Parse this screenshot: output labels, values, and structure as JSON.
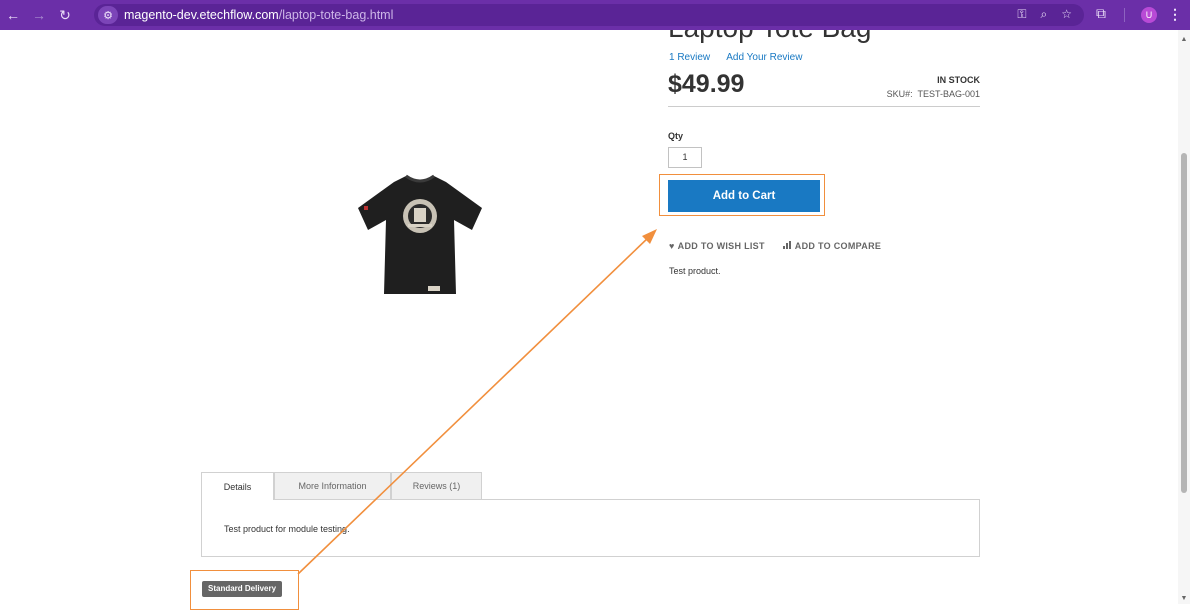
{
  "browser": {
    "url_host": "magento-dev.etechflow.com",
    "url_path": "/laptop-tote-bag.html",
    "avatar_initial": "U",
    "theme_color": "#6b2fa8"
  },
  "product": {
    "title": "Laptop Tote Bag",
    "review_count_label": "1  Review",
    "add_review_label": "Add Your Review",
    "price": "$49.99",
    "stock_status": "IN STOCK",
    "sku_label": "SKU#:",
    "sku_value": "TEST-BAG-001",
    "qty_label": "Qty",
    "qty_value": "1",
    "add_to_cart_label": "Add to Cart",
    "wishlist_label": "ADD TO WISH LIST",
    "compare_label": "ADD TO COMPARE",
    "short_description": "Test product.",
    "accent_color": "#1979c3"
  },
  "tabs": {
    "items": [
      {
        "label": "Details"
      },
      {
        "label": "More Information"
      },
      {
        "label": "Reviews (1)"
      }
    ],
    "active_content": "Test product for module testing."
  },
  "delivery": {
    "badge_label": "Standard Delivery"
  },
  "annotation": {
    "color": "#f18f3d"
  }
}
